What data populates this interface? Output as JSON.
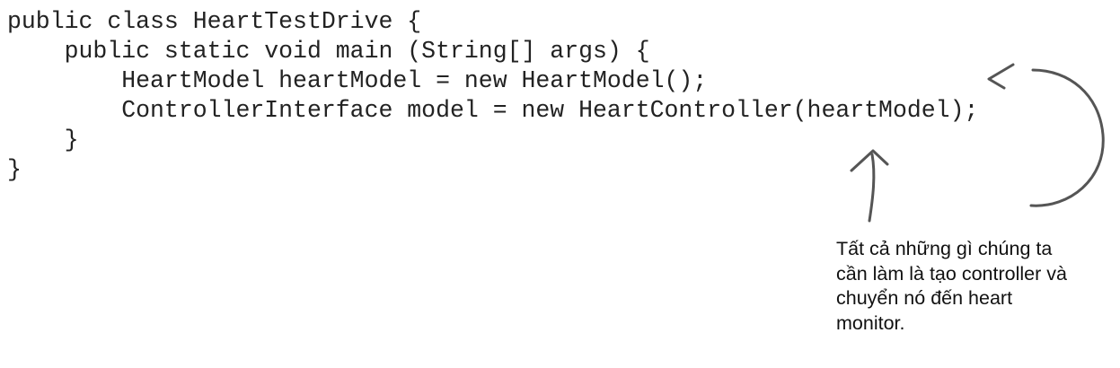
{
  "code": {
    "lines": [
      "public class HeartTestDrive {",
      "    public static void main (String[] args) {",
      "        HeartModel heartModel = new HeartModel();",
      "        ControllerInterface model = new HeartController(heartModel);",
      "    }",
      "}"
    ]
  },
  "annotation": {
    "lines": [
      "Tất cả những gì chúng ta",
      "cần làm là tạo controller và",
      "chuyển nó đến heart",
      "monitor."
    ]
  },
  "colors": {
    "code_text": "#222222",
    "arrow": "#555555",
    "background": "#ffffff"
  }
}
